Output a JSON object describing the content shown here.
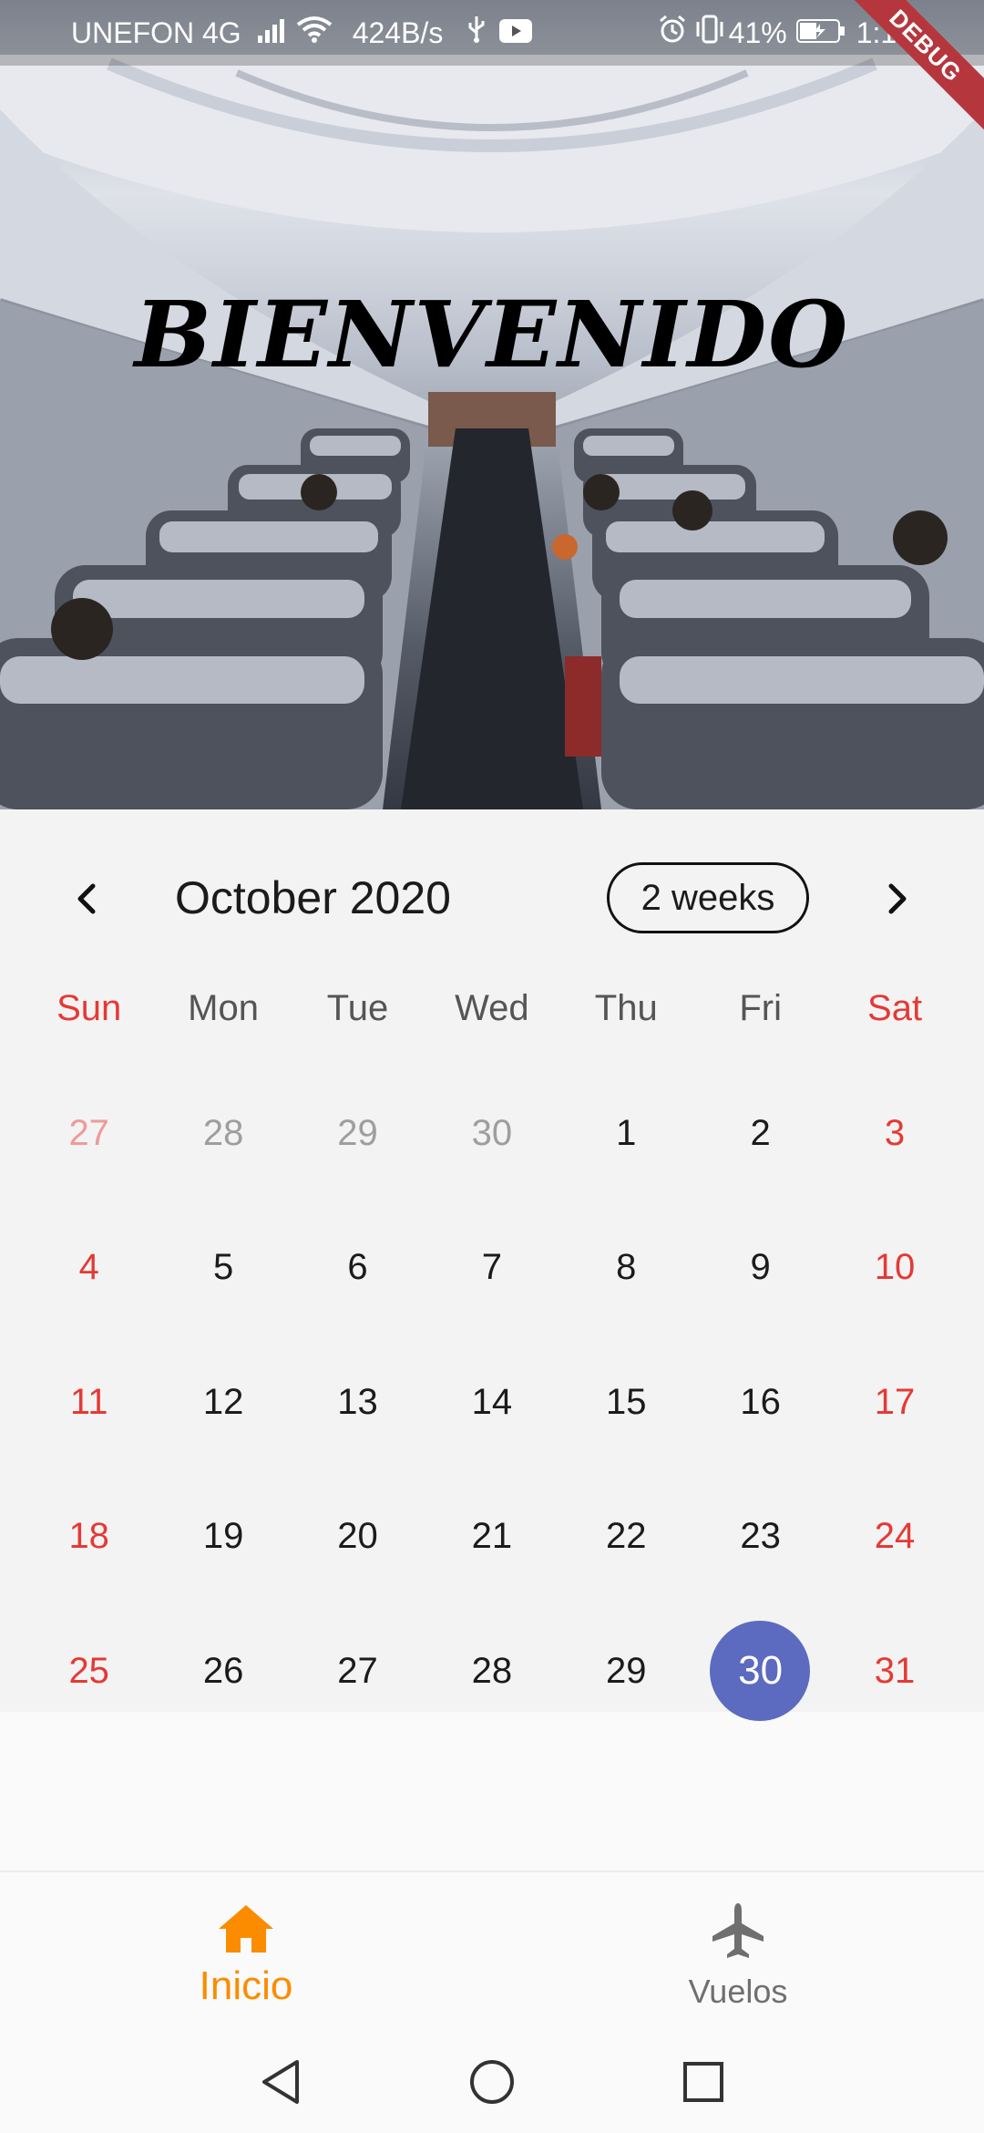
{
  "status_bar": {
    "carrier": "UNEFON 4G",
    "speed": "424B/s",
    "battery": "41%",
    "time": "1:15",
    "debug": "DEBUG"
  },
  "hero": {
    "title": "BIENVENIDO"
  },
  "calendar": {
    "month_title": "October 2020",
    "format_button": "2 weeks",
    "weekdays": [
      "Sun",
      "Mon",
      "Tue",
      "Wed",
      "Thu",
      "Fri",
      "Sat"
    ],
    "selected_day": "30",
    "weeks": [
      [
        "27",
        "28",
        "29",
        "30",
        "1",
        "2",
        "3"
      ],
      [
        "4",
        "5",
        "6",
        "7",
        "8",
        "9",
        "10"
      ],
      [
        "11",
        "12",
        "13",
        "14",
        "15",
        "16",
        "17"
      ],
      [
        "18",
        "19",
        "20",
        "21",
        "22",
        "23",
        "24"
      ],
      [
        "25",
        "26",
        "27",
        "28",
        "29",
        "30",
        "31"
      ]
    ]
  },
  "bottom_nav": {
    "items": [
      {
        "label": "Inicio",
        "icon": "home-icon",
        "active": true
      },
      {
        "label": "Vuelos",
        "icon": "airplane-icon",
        "active": false
      }
    ]
  },
  "colors": {
    "accent": "#fb8c00",
    "selected": "#5c6bc0",
    "weekend": "#e53935"
  }
}
